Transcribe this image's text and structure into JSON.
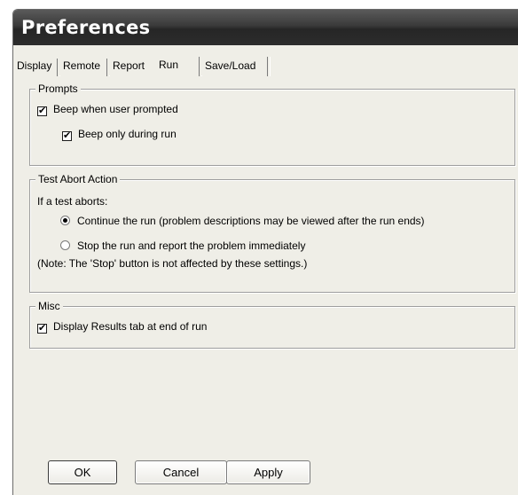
{
  "window": {
    "title": "Preferences"
  },
  "tabs": [
    {
      "label": "Display",
      "active": false
    },
    {
      "label": "Remote",
      "active": false
    },
    {
      "label": "Report",
      "active": false
    },
    {
      "label": "Run",
      "active": true
    },
    {
      "label": "Save/Load",
      "active": false
    }
  ],
  "prompts": {
    "legend": "Prompts",
    "beep_prompted": {
      "label": "Beep when user prompted",
      "checked": true,
      "mark": "✔"
    },
    "beep_during_run": {
      "label": "Beep only during run",
      "checked": true,
      "mark": "✔"
    }
  },
  "abort": {
    "legend": "Test Abort Action",
    "intro": "If a test aborts:",
    "continue": {
      "label": "Continue the run (problem descriptions may be viewed after the run ends)",
      "selected": true
    },
    "stop": {
      "label": "Stop the run and report the problem immediately",
      "selected": false
    },
    "note": "(Note: The 'Stop' button is not affected by these settings.)"
  },
  "misc": {
    "legend": "Misc",
    "display_results": {
      "label": "Display Results tab at end of run",
      "checked": true,
      "mark": "✔"
    }
  },
  "buttons": {
    "ok": "OK",
    "cancel": "Cancel",
    "apply": "Apply"
  }
}
